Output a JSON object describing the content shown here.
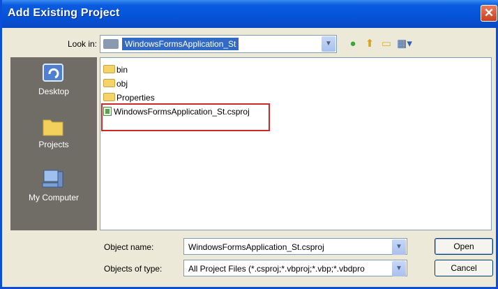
{
  "window": {
    "title": "Add Existing Project"
  },
  "look_in": {
    "label": "Look in:",
    "value": "WindowsFormsApplication_St"
  },
  "places": [
    {
      "label": "Desktop",
      "icon": "desktop-icon"
    },
    {
      "label": "Projects",
      "icon": "folder-icon"
    },
    {
      "label": "My Computer",
      "icon": "computer-icon"
    }
  ],
  "files": [
    {
      "name": "bin",
      "kind": "folder"
    },
    {
      "name": "obj",
      "kind": "folder"
    },
    {
      "name": "Properties",
      "kind": "folder"
    },
    {
      "name": "WindowsFormsApplication_St.csproj",
      "kind": "project"
    }
  ],
  "object_name": {
    "label": "Object name:",
    "value": "WindowsFormsApplication_St.csproj"
  },
  "object_type": {
    "label": "Objects of type:",
    "value": "All Project Files (*.csproj;*.vbproj;*.vbp;*.vbdpro"
  },
  "buttons": {
    "open": "Open",
    "cancel": "Cancel"
  },
  "colors": {
    "titlebar": "#0553d8",
    "selection": "#316ac5",
    "highlight_box": "#cc2a2a",
    "places_bg": "#6f6d66"
  }
}
